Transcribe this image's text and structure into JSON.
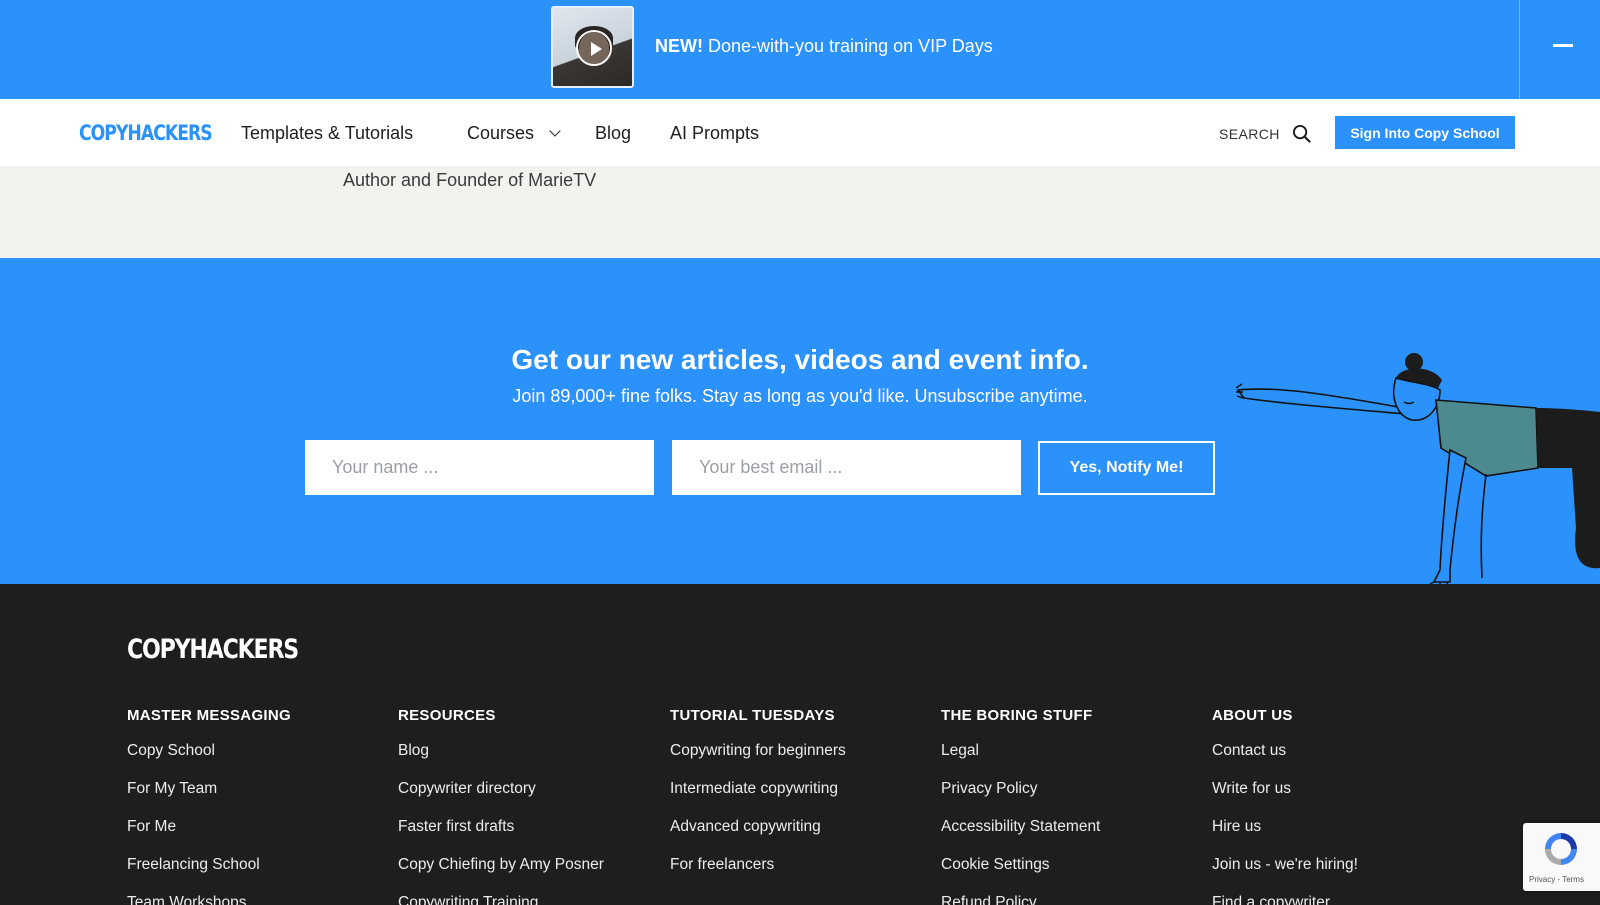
{
  "promo": {
    "badge": "NEW!",
    "text": " Done-with-you training on VIP Days"
  },
  "nav": {
    "logo": "COPYHACKERS",
    "links": [
      "Templates & Tutorials",
      "Courses",
      "Blog",
      "AI Prompts"
    ],
    "search_label": "SEARCH",
    "signin_label": "Sign Into Copy School"
  },
  "testimonial": {
    "author_role": "Author and Founder of MarieTV"
  },
  "subscribe": {
    "title": "Get our new articles, videos and event info.",
    "subtitle": "Join 89,000+ fine folks. Stay as long as you'd like. Unsubscribe anytime.",
    "name_placeholder": "Your name ...",
    "email_placeholder": "Your best email ...",
    "button_label": "Yes, Notify Me!"
  },
  "footer": {
    "logo": "COPYHACKERS",
    "columns": [
      {
        "title": "MASTER MESSAGING",
        "items": [
          "Copy School",
          "For My Team",
          "For Me",
          "Freelancing School",
          "Team Workshops"
        ]
      },
      {
        "title": "RESOURCES",
        "items": [
          "Blog",
          "Copywriter directory",
          "Faster first drafts",
          "Copy Chiefing by Amy Posner",
          "Copywriting Training"
        ]
      },
      {
        "title": "TUTORIAL TUESDAYS",
        "items": [
          "Copywriting for beginners",
          "Intermediate copywriting",
          "Advanced copywriting",
          "For freelancers"
        ]
      },
      {
        "title": "THE BORING STUFF",
        "items": [
          "Legal",
          "Privacy Policy",
          "Accessibility Statement",
          "Cookie Settings",
          "Refund Policy"
        ]
      },
      {
        "title": "ABOUT US",
        "items": [
          "Contact us",
          "Write for us",
          "Hire us",
          "Join us - we're hiring!",
          "Find a copywriter"
        ]
      }
    ]
  },
  "recaptcha": {
    "terms": "Privacy - Terms"
  },
  "colors": {
    "brand_blue": "#2b91fb",
    "footer_bg": "#1e1e1e",
    "testimonial_bg": "#f3f2ee"
  }
}
